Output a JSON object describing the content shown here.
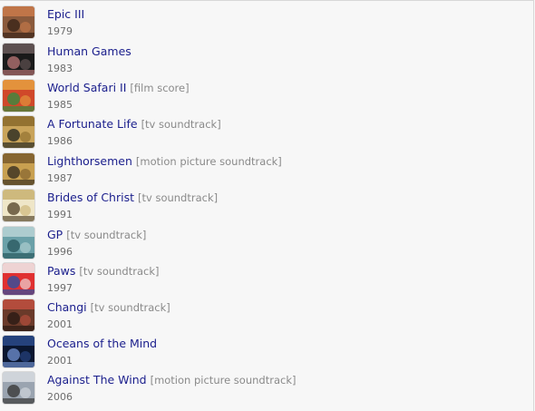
{
  "albums": [
    {
      "title": "Epic III",
      "tag": "",
      "year": "1979",
      "cover": "epic-iii-cover-icon",
      "c1": "#8a5a3c",
      "c2": "#c97a4a",
      "c3": "#3a2418"
    },
    {
      "title": "Human Games",
      "tag": "",
      "year": "1983",
      "cover": "human-games-cover-icon",
      "c1": "#1a1a1a",
      "c2": "#6a5a5a",
      "c3": "#b07070"
    },
    {
      "title": "World Safari II",
      "tag": "[film score]",
      "year": "1985",
      "cover": "world-safari-cover-icon",
      "c1": "#d0482a",
      "c2": "#e6a040",
      "c3": "#3a8a40"
    },
    {
      "title": "A Fortunate Life",
      "tag": "[tv soundtrack]",
      "year": "1986",
      "cover": "fortunate-life-cover-icon",
      "c1": "#c9a45a",
      "c2": "#8a6a2a",
      "c3": "#2a2a20"
    },
    {
      "title": "Lighthorsemen",
      "tag": "[motion picture soundtrack]",
      "year": "1987",
      "cover": "lighthorsemen-cover-icon",
      "c1": "#c8a050",
      "c2": "#7a5a2a",
      "c3": "#3a3020"
    },
    {
      "title": "Brides of Christ",
      "tag": "[tv soundtrack]",
      "year": "1991",
      "cover": "brides-of-christ-cover-icon",
      "c1": "#efe6c8",
      "c2": "#c8b070",
      "c3": "#5a4a30"
    },
    {
      "title": "GP",
      "tag": "[tv soundtrack]",
      "year": "1996",
      "cover": "gp-cover-icon",
      "c1": "#6aa0a8",
      "c2": "#b8d4d6",
      "c3": "#2a5a60"
    },
    {
      "title": "Paws",
      "tag": "[tv soundtrack]",
      "year": "1997",
      "cover": "paws-cover-icon",
      "c1": "#e03030",
      "c2": "#f0f0f0",
      "c3": "#3050a0"
    },
    {
      "title": "Changi",
      "tag": "[tv soundtrack]",
      "year": "2001",
      "cover": "changi-cover-icon",
      "c1": "#6a3a2a",
      "c2": "#c05040",
      "c3": "#2a1a14"
    },
    {
      "title": "Oceans of the Mind",
      "tag": "",
      "year": "2001",
      "cover": "oceans-of-the-mind-cover-icon",
      "c1": "#0a1630",
      "c2": "#2a4a8a",
      "c3": "#6a8ac8"
    },
    {
      "title": "Against The Wind",
      "tag": "[motion picture soundtrack]",
      "year": "2006",
      "cover": "against-the-wind-cover-icon",
      "c1": "#9aa4b0",
      "c2": "#d8dde2",
      "c3": "#3a3a3a"
    }
  ]
}
